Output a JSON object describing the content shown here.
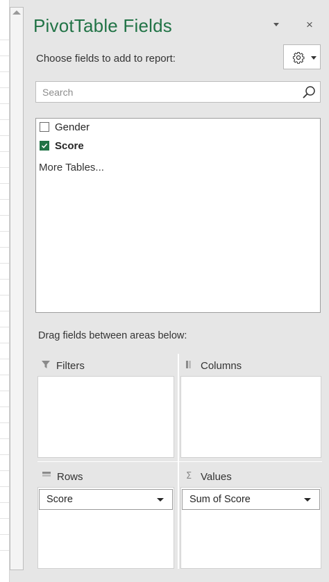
{
  "pane": {
    "title": "PivotTable Fields",
    "choose_label": "Choose fields to add to report:",
    "close_symbol": "×",
    "accent_color": "#217346"
  },
  "search": {
    "placeholder": "Search",
    "value": ""
  },
  "fields": [
    {
      "label": "Gender",
      "checked": false
    },
    {
      "label": "Score",
      "checked": true
    }
  ],
  "more_tables": "More Tables...",
  "drag_label": "Drag fields between areas below:",
  "areas": {
    "filters": {
      "label": "Filters",
      "icon": "filter-icon",
      "items": []
    },
    "columns": {
      "label": "Columns",
      "icon": "columns-icon",
      "items": []
    },
    "rows": {
      "label": "Rows",
      "icon": "rows-icon",
      "items": [
        "Score"
      ]
    },
    "values": {
      "label": "Values",
      "icon": "sigma-icon",
      "items": [
        "Sum of Score"
      ]
    }
  }
}
